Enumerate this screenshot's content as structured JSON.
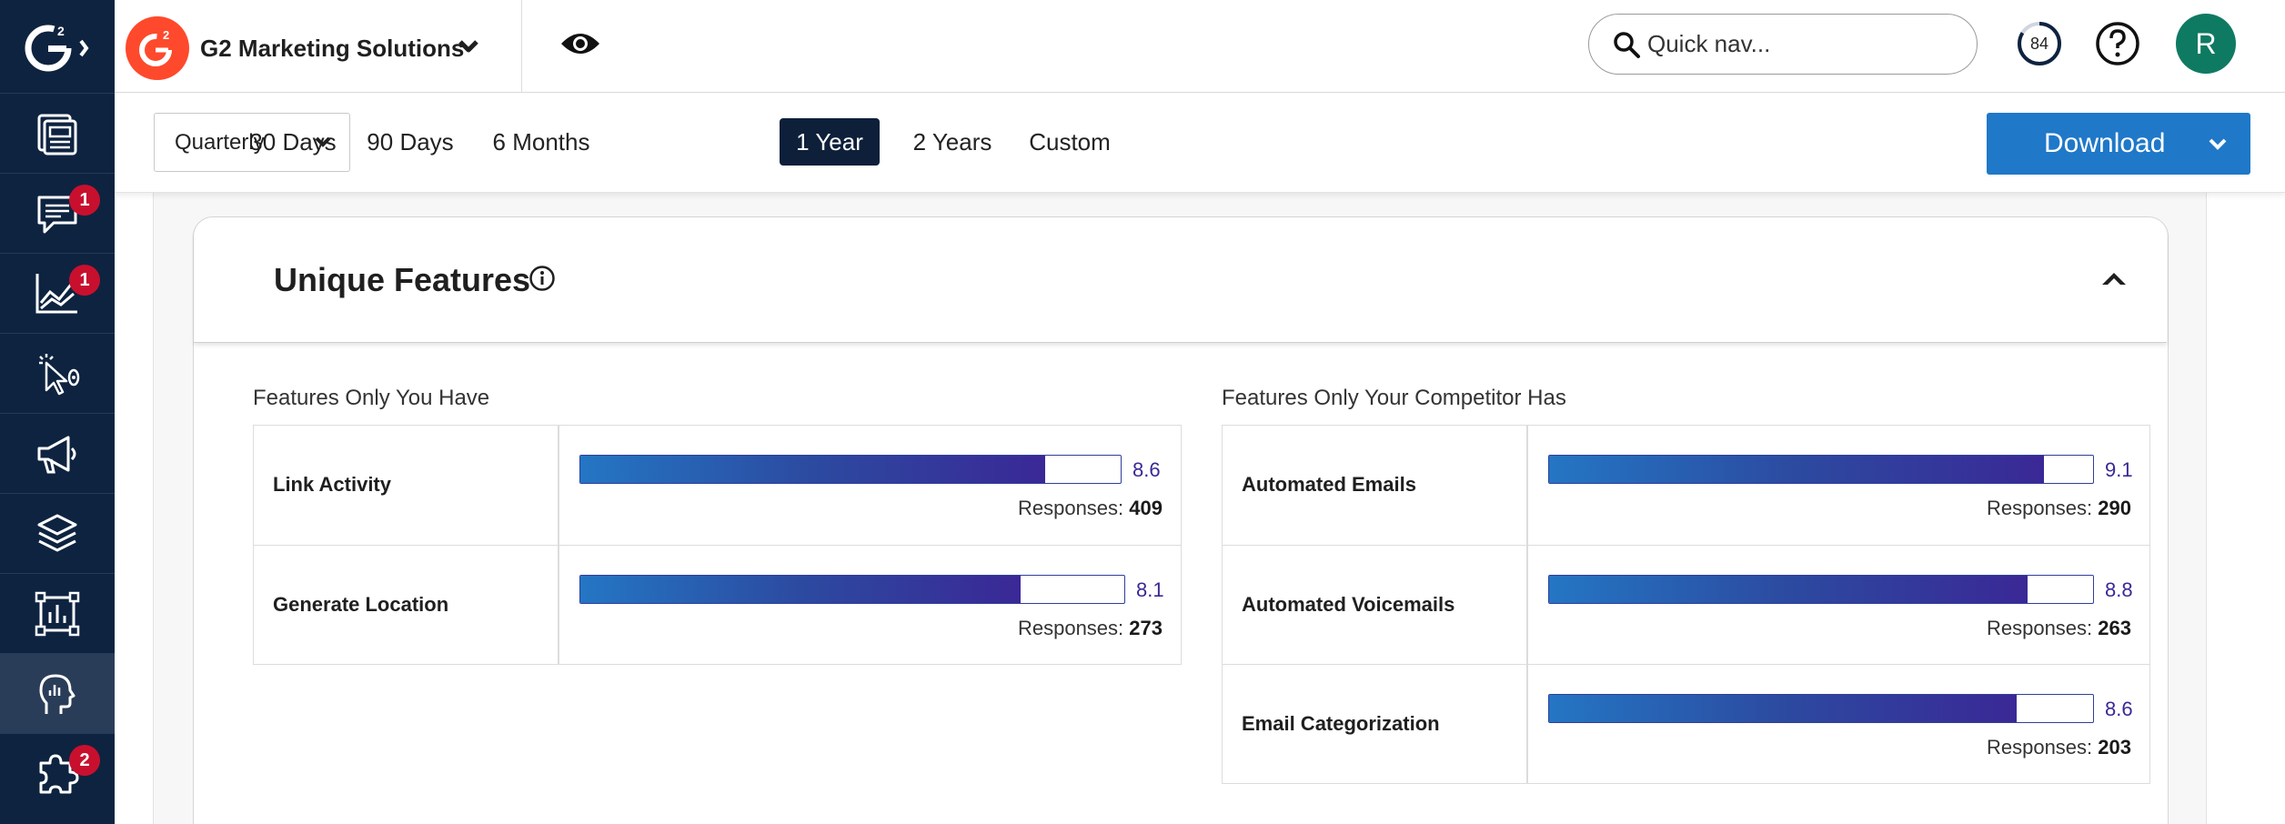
{
  "sidebar": {
    "logo_alt": "G2",
    "items": [
      {
        "icon": "reports-icon",
        "badge": ""
      },
      {
        "icon": "chat-icon",
        "badge": "1"
      },
      {
        "icon": "analytics-icon",
        "badge": "1"
      },
      {
        "icon": "intent-icon",
        "badge": ""
      },
      {
        "icon": "megaphone-icon",
        "badge": ""
      },
      {
        "icon": "layers-icon",
        "badge": ""
      },
      {
        "icon": "chart-frame-icon",
        "badge": ""
      },
      {
        "icon": "head-insights-icon",
        "badge": ""
      },
      {
        "icon": "puzzle-icon",
        "badge": "2"
      }
    ]
  },
  "topbar": {
    "company": "G2 Marketing Solutions",
    "search_placeholder": "Quick nav...",
    "score": "84",
    "avatar_initial": "R"
  },
  "filters": {
    "period": "Quarterly",
    "ranges": [
      "30 Days",
      "90 Days",
      "6 Months",
      "1 Year",
      "2 Years",
      "Custom"
    ],
    "active_range": "1 Year",
    "download_label": "Download"
  },
  "card": {
    "title": "Unique Features",
    "left": {
      "title": "Features Only You Have",
      "rows": [
        {
          "name": "Link Activity",
          "score": "8.6",
          "responses_label": "Responses:",
          "responses": "409",
          "fill": 0.86
        },
        {
          "name": "Generate Location",
          "score": "8.1",
          "responses_label": "Responses:",
          "responses": "273",
          "fill": 0.81
        }
      ]
    },
    "right": {
      "title": "Features Only Your Competitor Has",
      "rows": [
        {
          "name": "Automated Emails",
          "score": "9.1",
          "responses_label": "Responses:",
          "responses": "290",
          "fill": 0.91
        },
        {
          "name": "Automated Voicemails",
          "score": "8.8",
          "responses_label": "Responses:",
          "responses": "263",
          "fill": 0.88
        },
        {
          "name": "Email Categorization",
          "score": "8.6",
          "responses_label": "Responses:",
          "responses": "203",
          "fill": 0.86
        }
      ]
    }
  },
  "colors": {
    "sidebar_bg": "#0e2340",
    "brand_red": "#ff492c",
    "badge_red": "#c8102e",
    "download_blue": "#1f78c8",
    "active_range_bg": "#0e1f3a",
    "score_purple": "#3a2896",
    "avatar_green": "#0f7a62"
  }
}
